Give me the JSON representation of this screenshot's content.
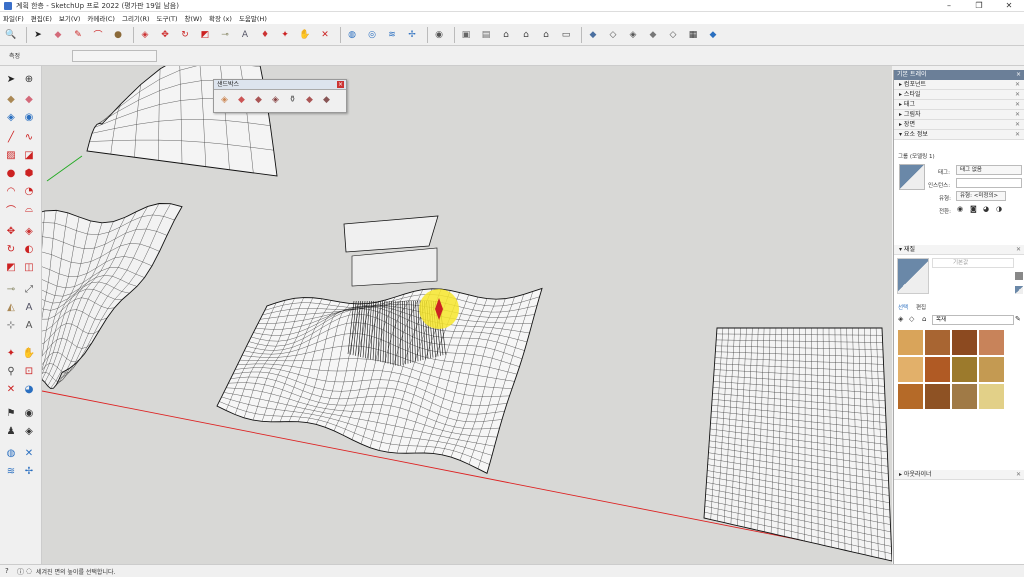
{
  "window": {
    "title": "계획 한층 - SketchUp 프로 2022 (평가판 19일 남음)",
    "minimize": "–",
    "restore": "❐",
    "close": "✕"
  },
  "menu": [
    "파일(F)",
    "편집(E)",
    "보기(V)",
    "카메라(C)",
    "그리기(R)",
    "도구(T)",
    "창(W)",
    "확장 (x)",
    "도움말(H)"
  ],
  "measurements": {
    "label": "측정"
  },
  "sandbox": {
    "title": "샌드박스",
    "close": "×"
  },
  "tray": {
    "title": "기본 트레이",
    "close": "×",
    "sections": [
      "컴포넌트",
      "스타일",
      "태그",
      "그림자",
      "장면"
    ],
    "entity_info": {
      "header": "요소 정보",
      "group_name": "그룹 (모델링 1)",
      "tag_label": "태그:",
      "tag_value": "태그 없음",
      "instance_label": "인스턴스:",
      "type_label": "유형:",
      "type_value": "유형: <미정의>",
      "toggles_label": "전환:"
    },
    "materials": {
      "header": "재질",
      "material_name": "기본값",
      "tab_select": "선택",
      "tab_edit": "편집",
      "category": "목재",
      "swatch_colors": [
        "#d9a45a",
        "#a86532",
        "#8c4a20",
        "#c8835a",
        "#e2b06a",
        "#b05a24",
        "#9c7a2c",
        "#c49a52",
        "#b56a28",
        "#8e5224",
        "#a07a46",
        "#e2d088"
      ]
    },
    "outliner": "아웃라이너"
  },
  "status": {
    "message": "세겨진 면의 높이를 선택합니다."
  }
}
